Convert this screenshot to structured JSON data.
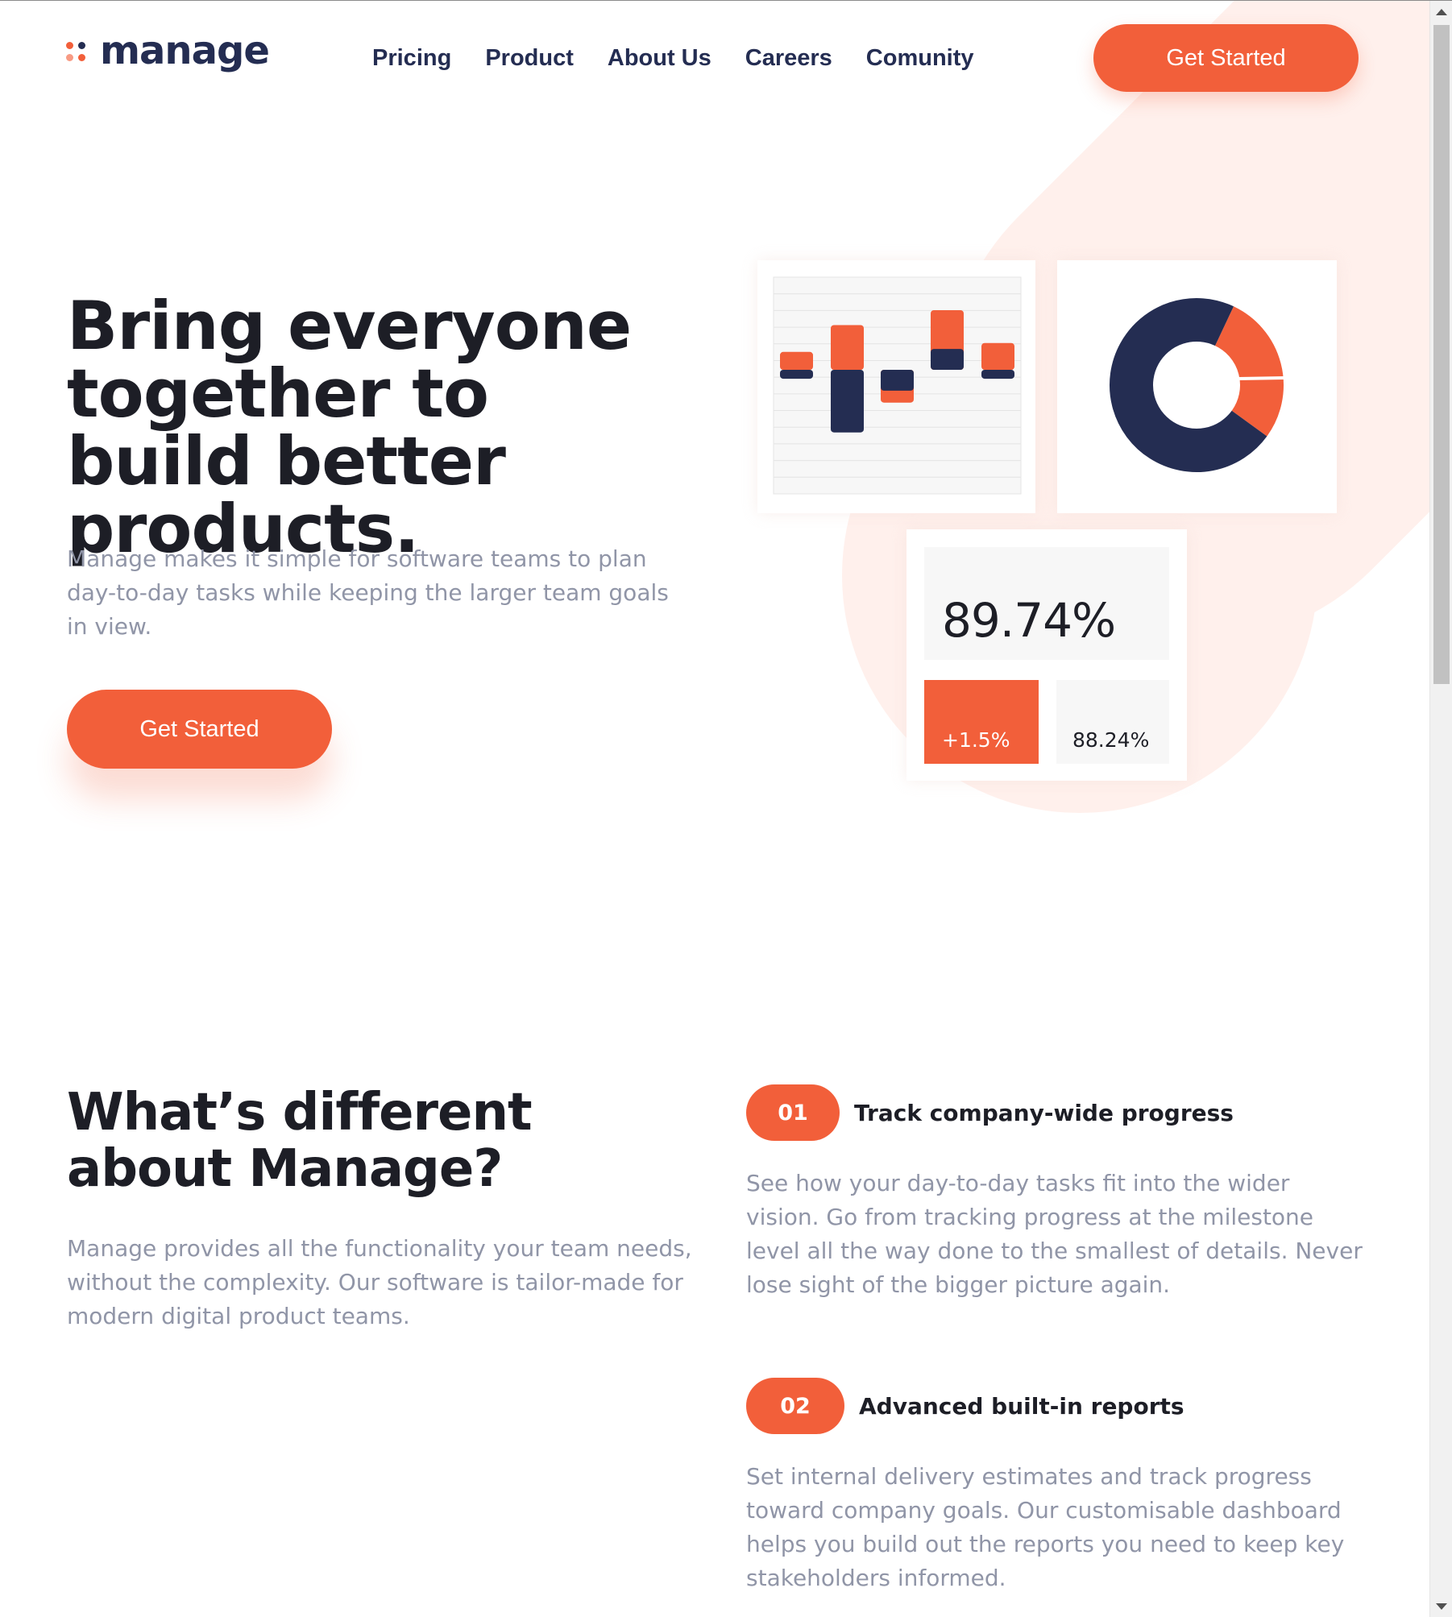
{
  "brand": {
    "name": "manage",
    "accent": "#f25f3a",
    "dark": "#242d52",
    "tint": "#fff0ec"
  },
  "nav": {
    "items": [
      "Pricing",
      "Product",
      "About Us",
      "Careers",
      "Comunity"
    ]
  },
  "header": {
    "cta_label": "Get Started"
  },
  "hero": {
    "title": "Bring everyone together to build better products.",
    "subtitle": "Manage makes it simple for software teams to plan day-to-day tasks while keeping the larger team goals in view.",
    "cta_label": "Get Started"
  },
  "dashboard": {
    "metric_value": "89.74%",
    "metric_delta": "+1.5%",
    "metric_secondary": "88.24%"
  },
  "chart_data": [
    {
      "type": "bar",
      "series": [
        {
          "name": "",
          "color": "#f25f3a",
          "values": [
            3,
            7.5,
            -5.5,
            10,
            4.5
          ]
        },
        {
          "name": "",
          "color": "#242d52",
          "values": [
            -1.5,
            -10.5,
            -3.5,
            3.5,
            -1.5
          ]
        }
      ]
    },
    {
      "type": "pie",
      "donut": true,
      "values": [
        28,
        72
      ],
      "colors": [
        "#f25f3a",
        "#242d52"
      ]
    }
  ],
  "features": {
    "title": "What’s different about Manage?",
    "subtitle": "Manage provides all the functionality your team needs, without the complexity. Our software is tailor-made for modern digital product teams.",
    "items": [
      {
        "num": "01",
        "title": "Track company-wide progress",
        "desc": "See how your day-to-day tasks fit into the wider vision. Go from tracking progress at the milestone level all the way done to the smallest of details. Never lose sight of the bigger picture again."
      },
      {
        "num": "02",
        "title": "Advanced built-in reports",
        "desc": "Set internal delivery estimates and track progress toward company goals. Our customisable dashboard helps you build out the reports you need to keep key stakeholders informed."
      }
    ]
  },
  "icons": [
    "logo-dots-icon",
    "scroll-up-arrow-icon",
    "scroll-down-arrow-icon"
  ]
}
